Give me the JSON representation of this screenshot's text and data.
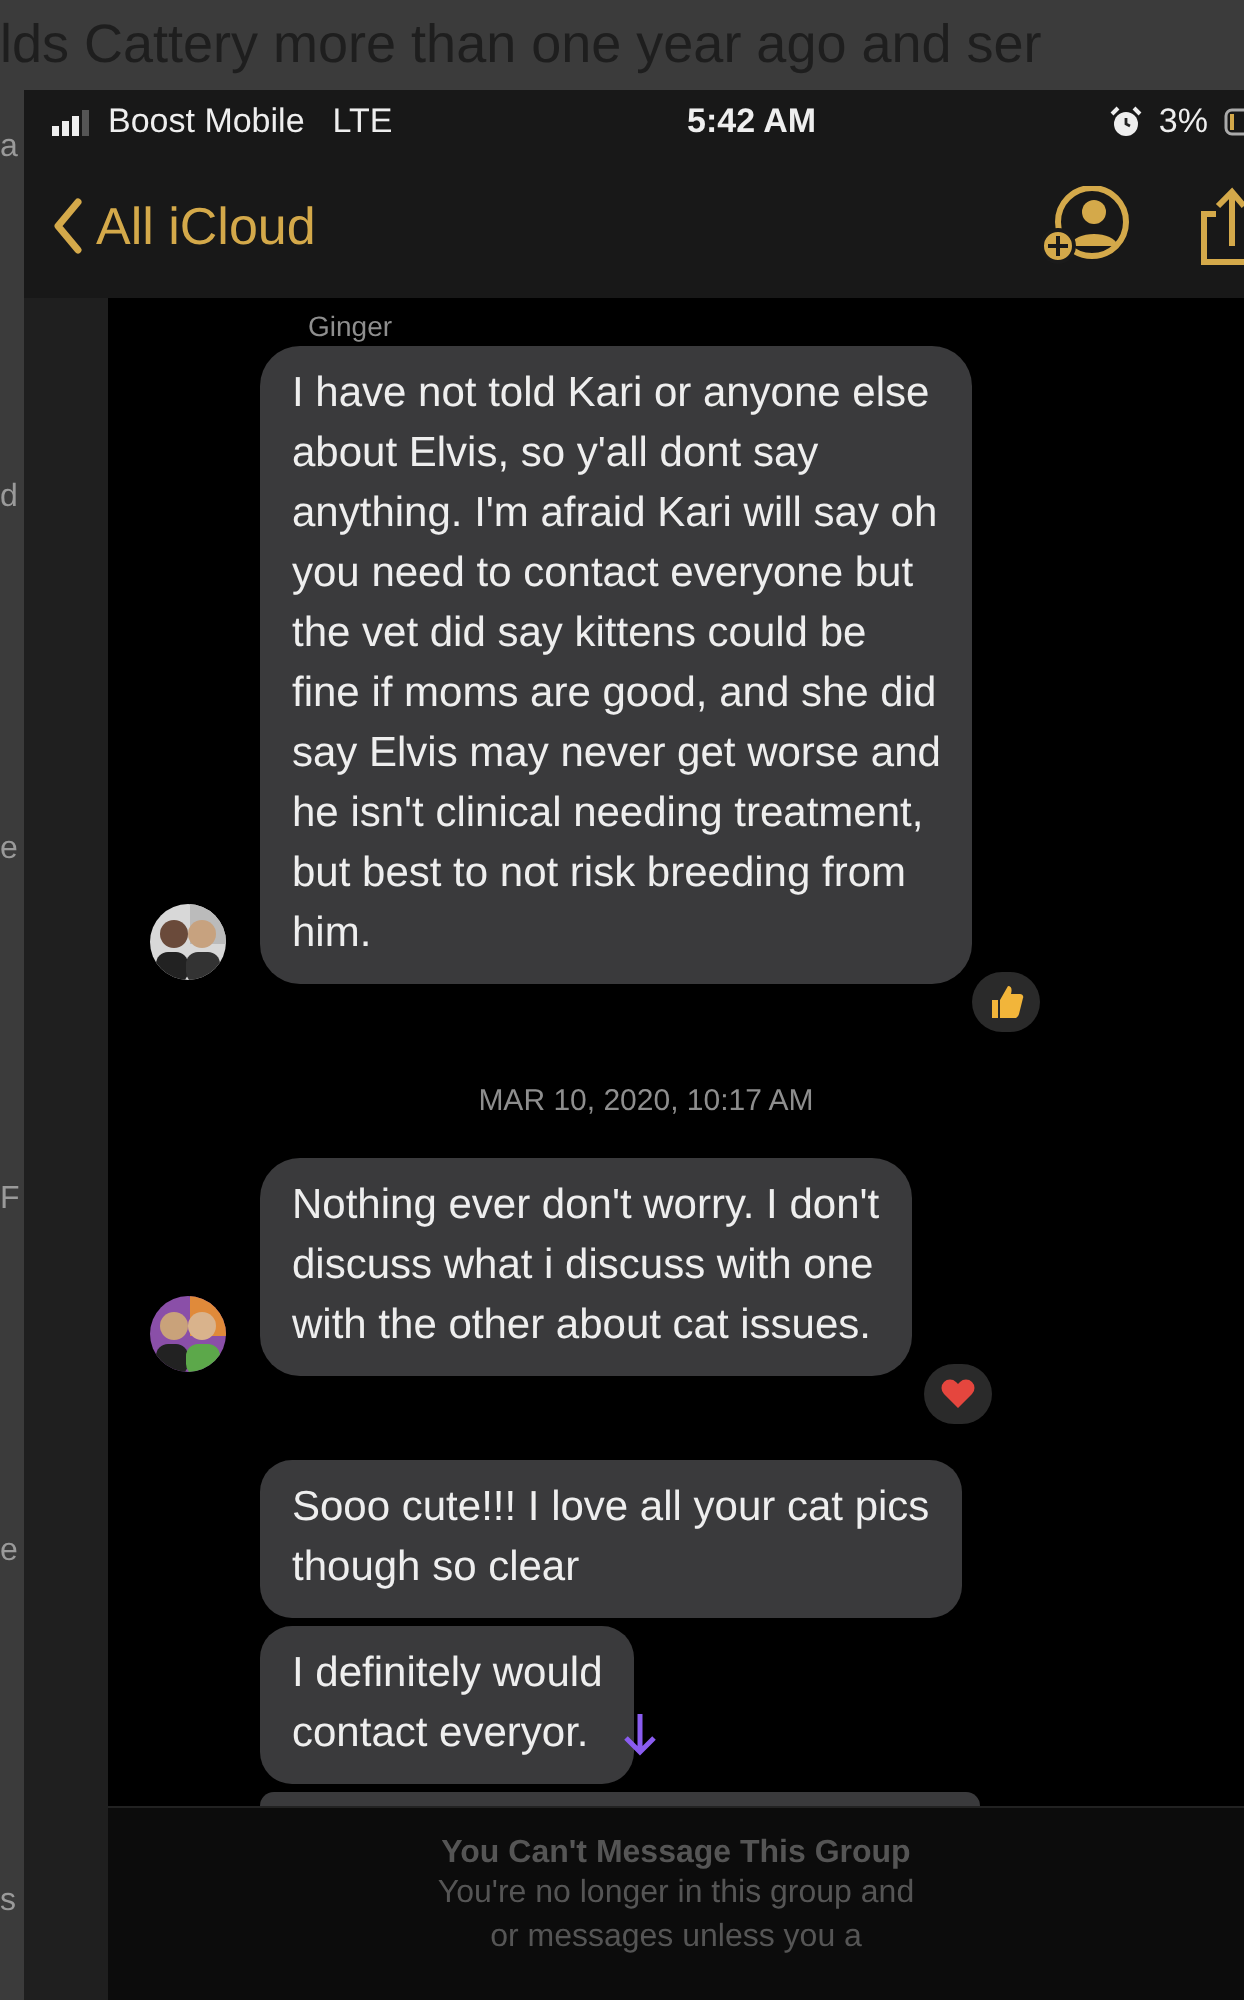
{
  "background_page": {
    "headline": "lds  Cattery more than one year ago and ser",
    "fragments": [
      "a",
      "d",
      "e",
      "F",
      "e",
      "s"
    ]
  },
  "status_bar": {
    "carrier": "Boost Mobile",
    "network": "LTE",
    "time": "5:42 AM",
    "battery": "3%"
  },
  "nav": {
    "back": "All iCloud"
  },
  "messages": [
    {
      "kind": "incoming",
      "sender": "Ginger",
      "avatar": {
        "kind": "pair"
      },
      "lines": [
        "I have not told Kari or anyone else",
        "about Elvis, so y'all dont say",
        "anything. I'm afraid Kari will say oh",
        "you need to contact everyone but",
        "the vet did say kittens could be",
        "fine if moms are good, and she did",
        "say Elvis may never get worse and",
        "he isn't clinical needing treatment,",
        "but best to not risk breeding from",
        "him."
      ],
      "reaction": {
        "kind": "thumbs"
      }
    },
    {
      "kind": "timestamp",
      "text": "MAR 10, 2020, 10:17 AM"
    },
    {
      "kind": "incoming",
      "avatar": {
        "kind": "group"
      },
      "lines": [
        "Nothing ever don't worry. I don't",
        "discuss what i discuss with one",
        "with the other about cat issues."
      ],
      "reaction": {
        "kind": "heart"
      }
    },
    {
      "kind": "outgoing_gray",
      "lines": [
        "Sooo cute!!! I love all your cat pics",
        "though so clear"
      ]
    },
    {
      "kind": "outgoing_gray",
      "lines": [
        "I definitely would",
        "contact everyor."
      ],
      "scroll_arrow": true
    },
    {
      "kind": "outgoing_gray"
    }
  ],
  "footer": {
    "title": "You Can't Message This Group",
    "lines": [
      "You're no longer in this group and",
      "or messages unless you a"
    ]
  }
}
